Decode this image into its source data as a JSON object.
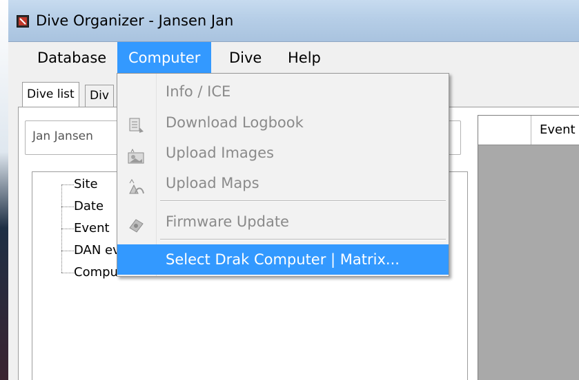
{
  "window": {
    "title": "Dive Organizer - Jansen Jan"
  },
  "menubar": {
    "items": [
      {
        "label": "Database"
      },
      {
        "label": "Computer"
      },
      {
        "label": "Dive"
      },
      {
        "label": "Help"
      }
    ],
    "active": "Computer"
  },
  "tabs": [
    {
      "label": "Dive list",
      "selected": true
    },
    {
      "label": "Div",
      "selected": false
    }
  ],
  "diver_field": {
    "value": "Jan Jansen"
  },
  "tree": {
    "items": [
      {
        "label": "Site"
      },
      {
        "label": "Date"
      },
      {
        "label": "Event"
      },
      {
        "label": "DAN ev"
      },
      {
        "label": "Computer"
      }
    ]
  },
  "right_table": {
    "columns": [
      {
        "label": "Event"
      }
    ]
  },
  "computer_menu": {
    "items": [
      {
        "label": "Info / ICE",
        "icon": "none",
        "enabled": false
      },
      {
        "label": "Download Logbook",
        "icon": "logbook-icon",
        "enabled": false
      },
      {
        "label": "Upload Images",
        "icon": "image-upload-icon",
        "enabled": false
      },
      {
        "label": "Upload Maps",
        "icon": "map-upload-icon",
        "enabled": false
      },
      {
        "label": "Firmware Update",
        "icon": "firmware-icon",
        "enabled": false
      },
      {
        "label": "Select Drak Computer | Matrix...",
        "icon": "none",
        "enabled": true,
        "highlighted": true
      }
    ]
  },
  "colors": {
    "menu_highlight": "#3399ff",
    "titlebar": "#b6cee7",
    "disabled_text": "#8a8a8a"
  }
}
